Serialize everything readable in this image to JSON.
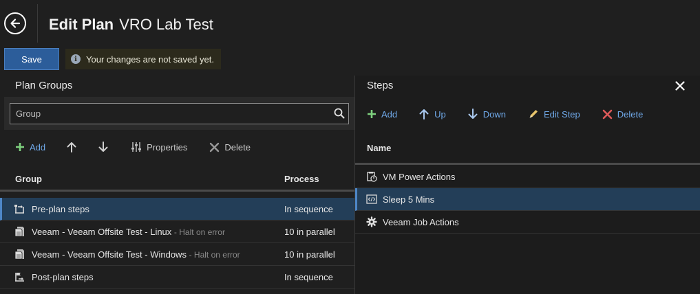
{
  "header": {
    "title_strong": "Edit Plan",
    "plan_name": "VRO Lab Test"
  },
  "actions": {
    "save_label": "Save",
    "unsaved_message": "Your changes are not saved yet."
  },
  "plan_groups": {
    "title": "Plan Groups",
    "search_placeholder": "Group",
    "toolbar": {
      "add": "Add",
      "properties": "Properties",
      "delete": "Delete"
    },
    "columns": {
      "group": "Group",
      "process": "Process"
    },
    "rows": [
      {
        "name": "Pre-plan steps",
        "note": "",
        "process": "In sequence",
        "icon": "pre-plan-steps-icon",
        "selected": true
      },
      {
        "name": "Veeam - Veeam Offsite Test - Linux",
        "note": "Halt on error",
        "process": "10 in parallel",
        "icon": "replica-group-icon",
        "selected": false
      },
      {
        "name": "Veeam - Veeam Offsite Test - Windows",
        "note": "Halt on error",
        "process": "10 in parallel",
        "icon": "replica-group-icon",
        "selected": false
      },
      {
        "name": "Post-plan steps",
        "note": "",
        "process": "In sequence",
        "icon": "post-plan-steps-icon",
        "selected": false
      }
    ]
  },
  "steps": {
    "title": "Steps",
    "toolbar": {
      "add": "Add",
      "up": "Up",
      "down": "Down",
      "edit_step": "Edit Step",
      "delete": "Delete"
    },
    "columns": {
      "name": "Name"
    },
    "rows": [
      {
        "name": "VM Power Actions",
        "icon": "vm-power-icon",
        "selected": false
      },
      {
        "name": "Sleep 5 Mins",
        "icon": "script-icon",
        "selected": true
      },
      {
        "name": "Veeam Job Actions",
        "icon": "gear-icon",
        "selected": false
      }
    ]
  },
  "colors": {
    "accent": "#2c5d9a",
    "link_blue": "#6fa8e8",
    "add_green": "#7ed07e",
    "delete_red": "#e05a5a",
    "selected_row": "#233e58"
  }
}
